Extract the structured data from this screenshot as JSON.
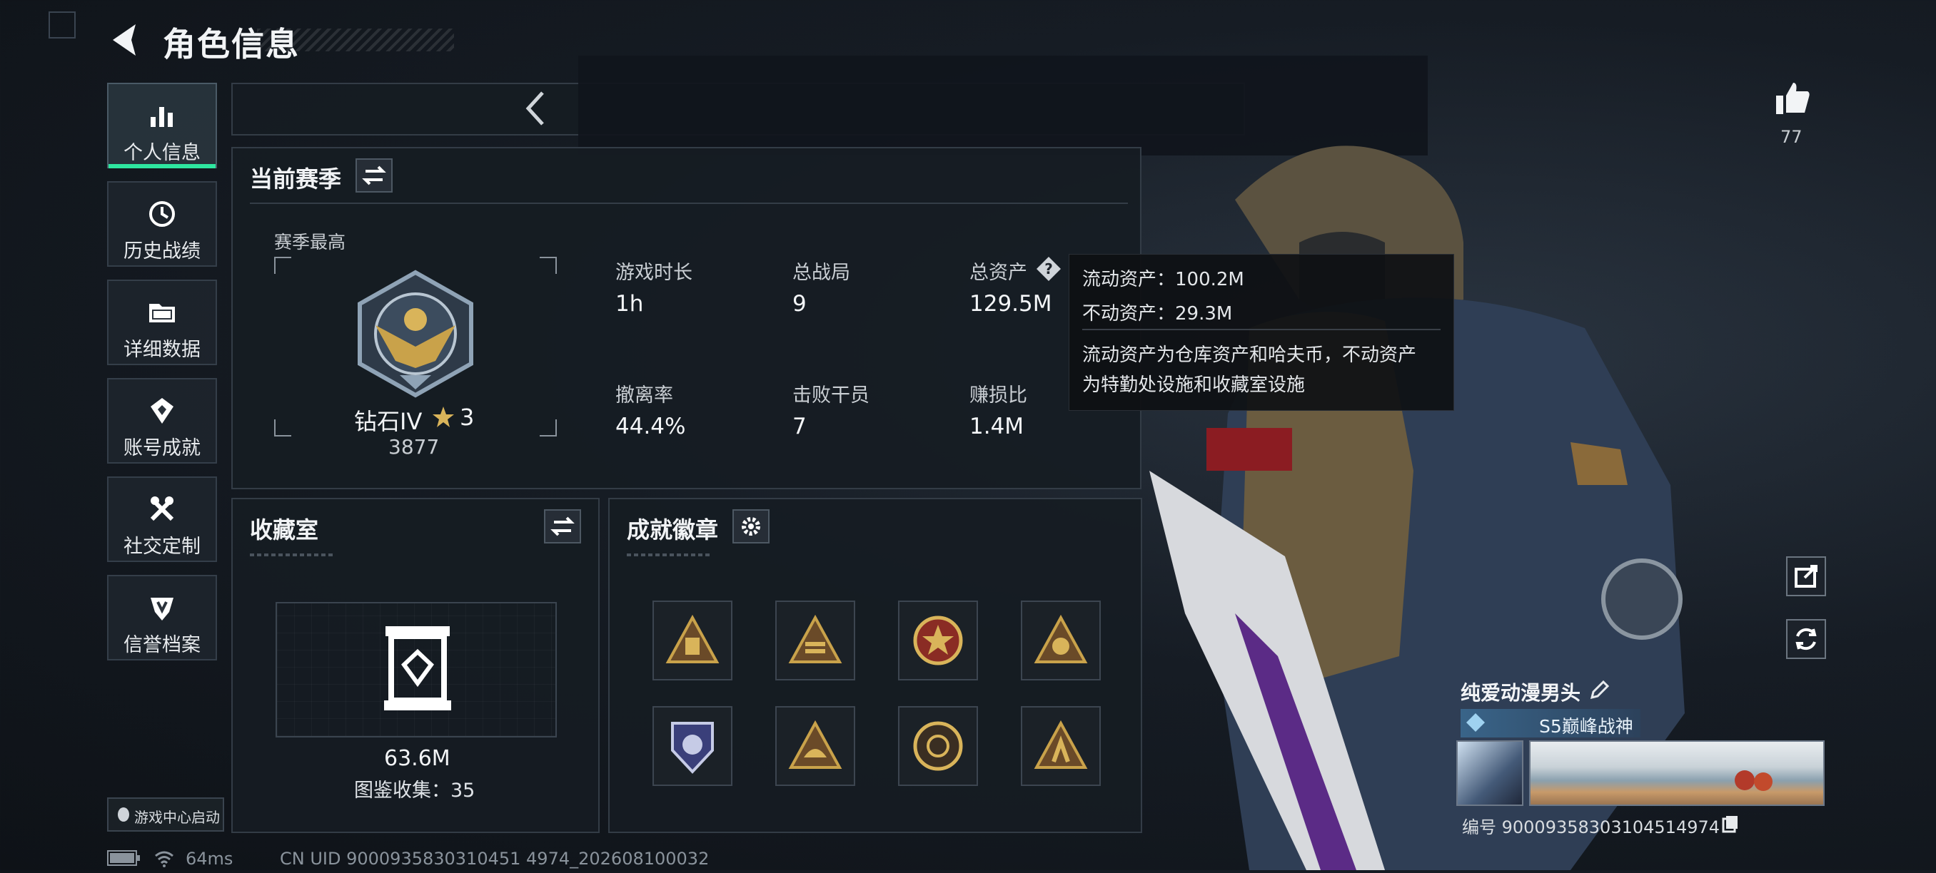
{
  "header": {
    "title": "角色信息"
  },
  "sidebar": {
    "items": [
      {
        "label": "个人信息",
        "icon": "bar-chart-icon",
        "active": true
      },
      {
        "label": "历史战绩",
        "icon": "history-icon"
      },
      {
        "label": "详细数据",
        "icon": "folder-icon"
      },
      {
        "label": "账号成就",
        "icon": "achievement-icon"
      },
      {
        "label": "社交定制",
        "icon": "tools-icon"
      },
      {
        "label": "信誉档案",
        "icon": "shield-icon"
      }
    ],
    "game_center": "游戏中心启动"
  },
  "season": {
    "title": "当前赛季",
    "highest_label": "赛季最高",
    "rank_name": "钻石IV",
    "rank_stars": "3",
    "rank_score": "3877",
    "stats": [
      {
        "label": "游戏时长",
        "value": "1h"
      },
      {
        "label": "总战局",
        "value": "9"
      },
      {
        "label": "总资产",
        "value": "129.5M"
      },
      {
        "label": "撤离率",
        "value": "44.4%"
      },
      {
        "label": "击败干员",
        "value": "7"
      },
      {
        "label": "赚损比",
        "value": "1.4M"
      }
    ]
  },
  "tooltip": {
    "line1": "流动资产：100.2M",
    "line2": "不动资产：29.3M",
    "desc1": "流动资产为仓库资产和哈夫币，不动资产",
    "desc2": "为特勤处设施和收藏室设施"
  },
  "collection": {
    "title": "收藏室",
    "value": "63.6M",
    "count_text": "图鉴收集：35"
  },
  "achievements": {
    "title": "成就徽章",
    "badges": [
      "badge-1",
      "badge-2",
      "badge-3",
      "badge-4",
      "badge-5",
      "badge-6",
      "badge-7",
      "badge-8"
    ]
  },
  "profile": {
    "likes": "77",
    "player_name": "纯爱动漫男头",
    "player_title": "S5巅峰战神",
    "id_text": "编号 900093583031045149​74"
  },
  "status_bar": {
    "ping": "64ms",
    "uid": "CN UID 9000935830310451 4974_202608100032"
  },
  "colors": {
    "accent": "#2ee6a0",
    "panel_bg": "#161c23",
    "gold": "#c9a24a"
  }
}
